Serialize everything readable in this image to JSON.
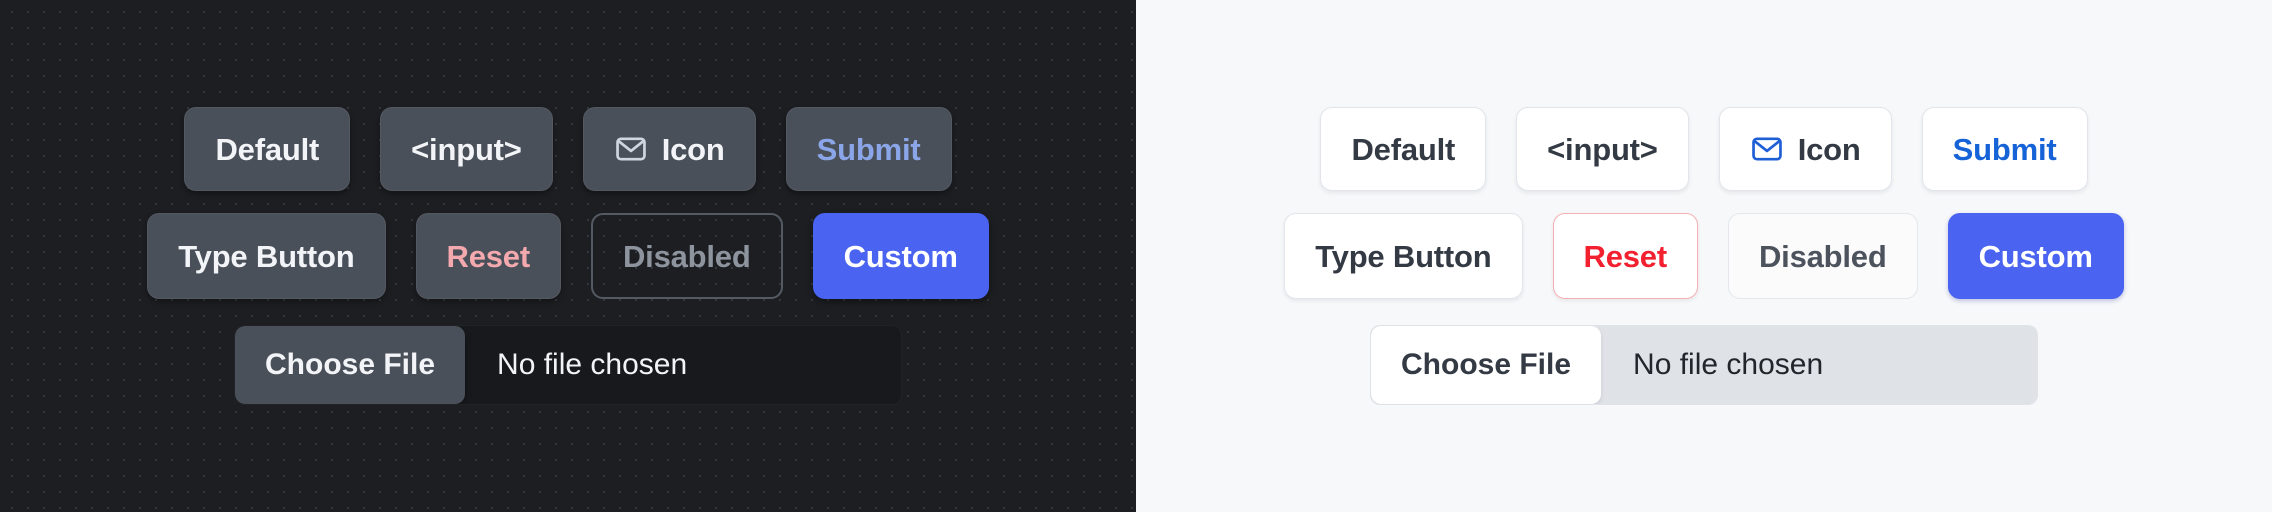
{
  "colors": {
    "dark_panel_bg": "#1c1e22",
    "light_panel_bg": "#f7f8fa",
    "dark_button_bg": "#4a5059",
    "light_button_bg": "#ffffff",
    "custom_blue": "#4a63f0",
    "dark_submit_text": "#8ba6e8",
    "light_submit_text": "#1663d8",
    "dark_reset_text": "#f3a9ae",
    "light_reset_text": "#f32030",
    "light_reset_border": "#f8b0b4",
    "dark_disabled_text": "#8d949e",
    "light_disabled_text": "#4c535d",
    "dark_file_track": "#17191c",
    "light_file_track": "#dfe2e7"
  },
  "panels": [
    {
      "theme": "dark",
      "rows": [
        [
          {
            "id": "default",
            "label": "Default",
            "variant": "default",
            "icon": null
          },
          {
            "id": "input",
            "label": "<input>",
            "variant": "default",
            "icon": null
          },
          {
            "id": "icon",
            "label": "Icon",
            "variant": "default",
            "icon": "mail-icon"
          },
          {
            "id": "submit",
            "label": "Submit",
            "variant": "submit",
            "icon": null
          }
        ],
        [
          {
            "id": "type-button",
            "label": "Type Button",
            "variant": "default",
            "icon": null
          },
          {
            "id": "reset",
            "label": "Reset",
            "variant": "reset",
            "icon": null
          },
          {
            "id": "disabled",
            "label": "Disabled",
            "variant": "disabled",
            "icon": null
          },
          {
            "id": "custom",
            "label": "Custom",
            "variant": "custom",
            "icon": null
          }
        ]
      ],
      "file_input": {
        "button_label": "Choose File",
        "file_name": "No file chosen"
      }
    },
    {
      "theme": "light",
      "rows": [
        [
          {
            "id": "default",
            "label": "Default",
            "variant": "default",
            "icon": null
          },
          {
            "id": "input",
            "label": "<input>",
            "variant": "default",
            "icon": null
          },
          {
            "id": "icon",
            "label": "Icon",
            "variant": "default",
            "icon": "mail-icon"
          },
          {
            "id": "submit",
            "label": "Submit",
            "variant": "submit",
            "icon": null
          }
        ],
        [
          {
            "id": "type-button",
            "label": "Type Button",
            "variant": "default",
            "icon": null
          },
          {
            "id": "reset",
            "label": "Reset",
            "variant": "reset",
            "icon": null
          },
          {
            "id": "disabled",
            "label": "Disabled",
            "variant": "disabled",
            "icon": null
          },
          {
            "id": "custom",
            "label": "Custom",
            "variant": "custom",
            "icon": null
          }
        ]
      ],
      "file_input": {
        "button_label": "Choose File",
        "file_name": "No file chosen"
      }
    }
  ]
}
